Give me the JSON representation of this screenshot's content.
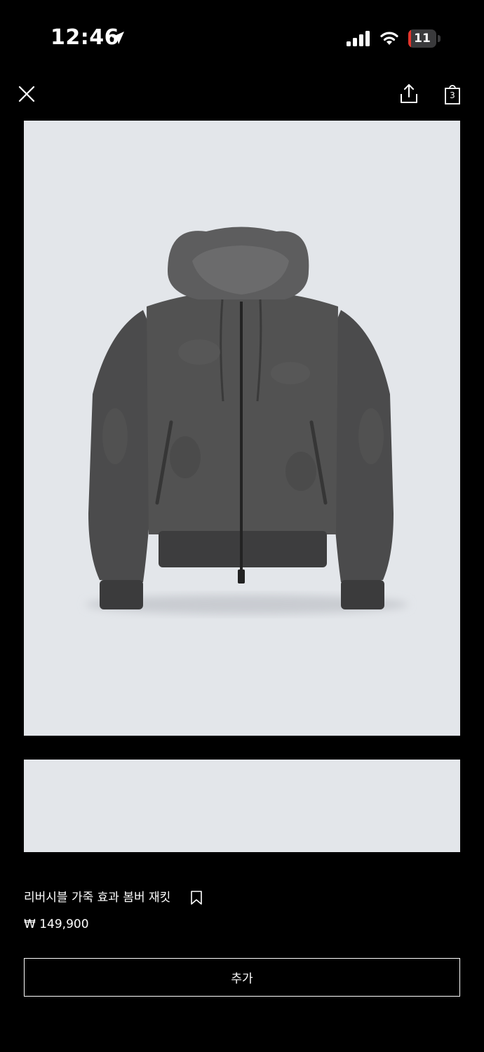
{
  "status_bar": {
    "time": "12:46",
    "battery_level": "11",
    "battery_fraction": 0.11,
    "battery_color": "#e5342b",
    "icons": [
      "location-arrow-icon",
      "signal-bars-icon",
      "wifi-icon",
      "battery-icon"
    ]
  },
  "nav": {
    "icons": [
      "close-icon",
      "share-icon",
      "shopping-bag-icon"
    ],
    "bag_count": "3"
  },
  "product": {
    "title": "리버시블 가죽 효과 봄버 재킷",
    "price": "₩ 149,900",
    "add_label": "추가",
    "image_background": "#e3e6ea"
  }
}
